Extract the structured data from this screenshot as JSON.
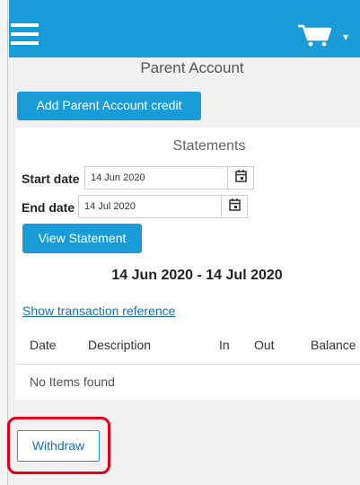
{
  "header": {
    "menu_icon": "hamburger-menu-icon",
    "cart_icon": "shopping-cart-icon",
    "cart_caret": "▾",
    "brand_color": "#1a9cd9"
  },
  "page": {
    "title": "Parent Account",
    "add_credit_label": "Add Parent Account credit"
  },
  "statements": {
    "title": "Statements",
    "start_label": "Start date",
    "start_value": "14 Jun 2020",
    "end_label": "End date",
    "end_value": "14 Jul 2020",
    "calendar_icon": "calendar-icon",
    "view_label": "View Statement",
    "range_text": "14 Jun 2020 - 14 Jul 2020",
    "show_ref_label": "Show transaction reference",
    "columns": [
      "Date",
      "Description",
      "In",
      "Out",
      "Balance"
    ],
    "empty_text": "No Items found"
  },
  "actions": {
    "withdraw_label": "Withdraw",
    "highlight_color": "#e0001b"
  }
}
